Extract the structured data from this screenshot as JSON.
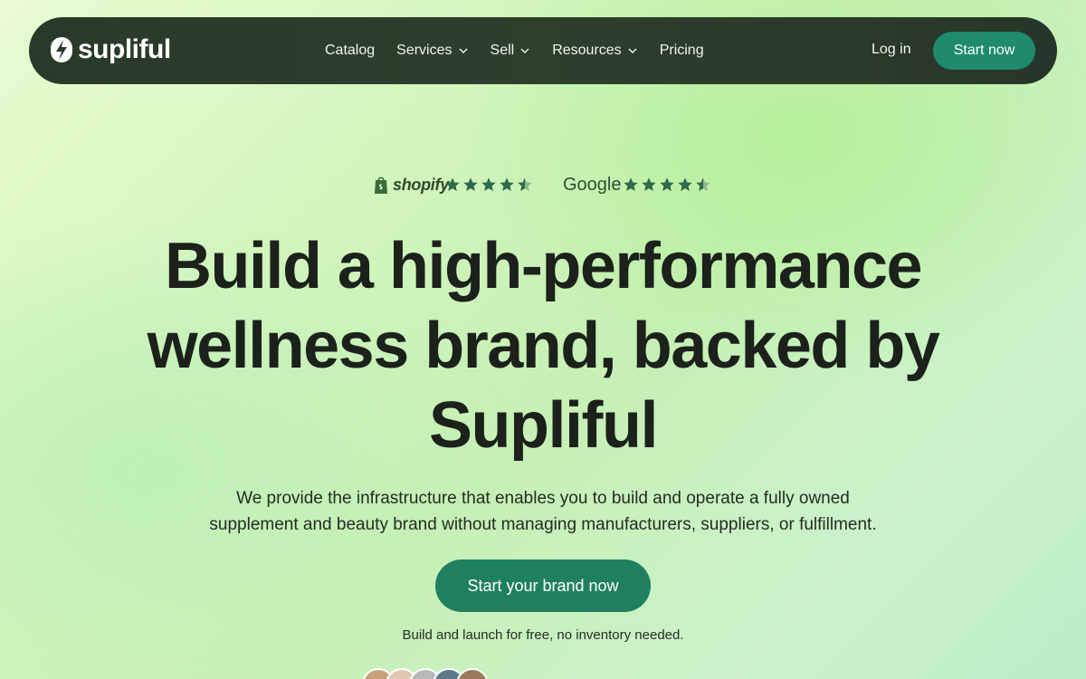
{
  "nav": {
    "logo_text": "supliful",
    "items": [
      {
        "label": "Catalog",
        "dropdown": false
      },
      {
        "label": "Services",
        "dropdown": true
      },
      {
        "label": "Sell",
        "dropdown": true
      },
      {
        "label": "Resources",
        "dropdown": true
      },
      {
        "label": "Pricing",
        "dropdown": false
      }
    ],
    "login_label": "Log in",
    "start_label": "Start now"
  },
  "ratings": {
    "shopify_label": "shopify",
    "shopify_stars": 4.5,
    "google_label": "Google",
    "google_stars": 4.5
  },
  "hero": {
    "headline_line1": "Build a high-performance",
    "headline_line2": "wellness brand, backed by",
    "headline_line3": "Supliful",
    "subtitle_line1": "We provide the infrastructure that enables you to build and operate a fully owned",
    "subtitle_line2": "supplement and beauty brand without managing manufacturers, suppliers, or fulfillment.",
    "cta_label": "Start your brand now",
    "note": "Build and launch for free, no inventory needed."
  },
  "colors": {
    "nav_bg": "#2a3a2a",
    "accent": "#1f8060",
    "star": "#2f6b4a"
  },
  "icons": [
    "supliful-logo-icon",
    "chevron-down-icon",
    "shopify-bag-icon",
    "star-icon",
    "half-star-icon",
    "avatar"
  ]
}
